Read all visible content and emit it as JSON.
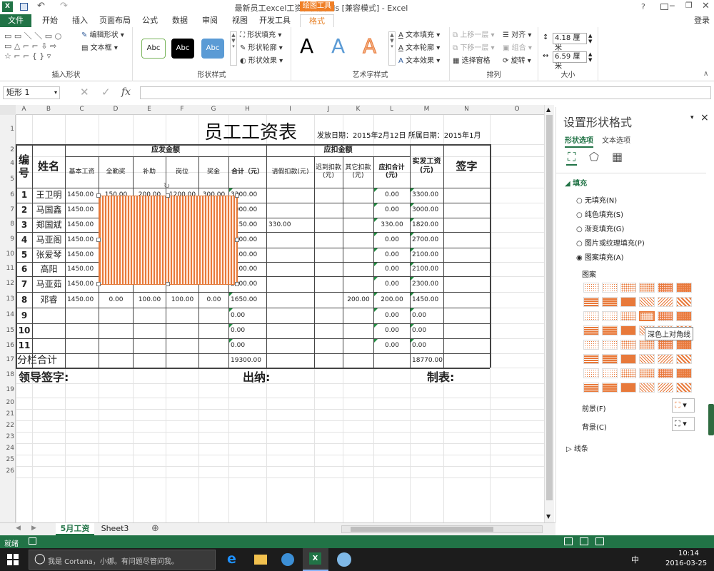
{
  "window": {
    "title": "最新员工excel工资表模板.xls [兼容模式] - Excel",
    "help": "?",
    "login": "登录"
  },
  "ribbon": {
    "tabs": [
      "文件",
      "开始",
      "插入",
      "页面布局",
      "公式",
      "数据",
      "审阅",
      "视图",
      "开发工具",
      "格式"
    ],
    "context_tab": "绘图工具",
    "insert_shapes": {
      "label": "插入形状",
      "edit_shape": "编辑形状",
      "textbox": "文本框"
    },
    "shape_styles": {
      "label": "形状样式",
      "style_text": "Abc",
      "fill": "形状填充",
      "outline": "形状轮廓",
      "effects": "形状效果"
    },
    "art_styles": {
      "label": "艺术字样式",
      "letter": "A",
      "text_fill": "文本填充",
      "text_outline": "文本轮廓",
      "text_effects": "文本效果"
    },
    "arrange": {
      "label": "排列",
      "bring_forward": "上移一层",
      "send_backward": "下移一层",
      "selection_pane": "选择窗格",
      "align": "对齐",
      "group": "组合",
      "rotate": "旋转"
    },
    "size": {
      "label": "大小",
      "height": "4.18 厘米",
      "width": "6.59 厘米"
    }
  },
  "formula_bar": {
    "name_box": "矩形 1",
    "fx": "fx"
  },
  "sheet": {
    "columns": [
      "A",
      "B",
      "C",
      "D",
      "E",
      "F",
      "G",
      "H",
      "I",
      "J",
      "K",
      "L",
      "M",
      "N",
      "O"
    ],
    "rows": [
      "1",
      "2",
      "4",
      "5",
      "6",
      "7",
      "8",
      "9",
      "10",
      "11",
      "12",
      "13",
      "14",
      "15",
      "16",
      "17",
      "18",
      "19",
      "20",
      "21",
      "22",
      "23",
      "24",
      "25",
      "26"
    ],
    "title": "员工工资表",
    "issue_info": "发放日期：2015年2月12日 所属日期：2015年1月",
    "h_no": "编号",
    "h_name": "姓名",
    "h_payable": "应发金额",
    "h_deduct": "应扣金额",
    "h_base": "基本工资",
    "h_bonus": "全勤奖",
    "h_subsidy": "补助",
    "h_post": "岗位",
    "h_prize": "奖金",
    "h_total": "合计（元）",
    "h_leave": "请假扣款(元)",
    "h_late": "迟到扣款(元)",
    "h_other": "其它扣款(元)",
    "h_dtotal": "应扣合计(元)",
    "h_net": "实发工资(元)",
    "h_sign": "签字",
    "data_rows": [
      {
        "no": "1",
        "name": "王卫明",
        "base": "1450.00",
        "bonus": "150.00",
        "subsidy": "200.00",
        "post": "1200.00",
        "prize": "300.00",
        "total": "3300.00",
        "leave": "",
        "late": "",
        "other": "",
        "dtotal": "0.00",
        "net": "3300.00"
      },
      {
        "no": "2",
        "name": "马国鑫",
        "base": "1450.00",
        "bonus": "",
        "subsidy": "",
        "post": "",
        "prize": "",
        "total": "3000.00",
        "leave": "",
        "late": "",
        "other": "",
        "dtotal": "0.00",
        "net": "3000.00"
      },
      {
        "no": "3",
        "name": "郑国斌",
        "base": "1450.00",
        "bonus": "",
        "subsidy": "",
        "post": "",
        "prize": "",
        "total": "2150.00",
        "leave": "330.00",
        "late": "",
        "other": "",
        "dtotal": "330.00",
        "net": "1820.00"
      },
      {
        "no": "4",
        "name": "马亚阁",
        "base": "1450.00",
        "bonus": "",
        "subsidy": "",
        "post": "",
        "prize": "",
        "total": "2700.00",
        "leave": "",
        "late": "",
        "other": "",
        "dtotal": "0.00",
        "net": "2700.00"
      },
      {
        "no": "5",
        "name": "张爱琴",
        "base": "1450.00",
        "bonus": "",
        "subsidy": "",
        "post": "",
        "prize": "",
        "total": "2100.00",
        "leave": "",
        "late": "",
        "other": "",
        "dtotal": "0.00",
        "net": "2100.00"
      },
      {
        "no": "6",
        "name": "高阳",
        "base": "1450.00",
        "bonus": "",
        "subsidy": "",
        "post": "",
        "prize": "",
        "total": "2100.00",
        "leave": "",
        "late": "",
        "other": "",
        "dtotal": "0.00",
        "net": "2100.00"
      },
      {
        "no": "7",
        "name": "马亚茹",
        "base": "1450.00",
        "bonus": "",
        "subsidy": "",
        "post": "",
        "prize": "",
        "total": "2300.00",
        "leave": "",
        "late": "",
        "other": "",
        "dtotal": "0.00",
        "net": "2300.00"
      },
      {
        "no": "8",
        "name": "邓睿",
        "base": "1450.00",
        "bonus": "0.00",
        "subsidy": "100.00",
        "post": "100.00",
        "prize": "0.00",
        "total": "1650.00",
        "leave": "",
        "late": "",
        "other": "200.00",
        "dtotal": "200.00",
        "net": "1450.00"
      },
      {
        "no": "9",
        "name": "",
        "base": "",
        "bonus": "",
        "subsidy": "",
        "post": "",
        "prize": "",
        "total": "0.00",
        "leave": "",
        "late": "",
        "other": "",
        "dtotal": "0.00",
        "net": "0.00"
      },
      {
        "no": "10",
        "name": "",
        "base": "",
        "bonus": "",
        "subsidy": "",
        "post": "",
        "prize": "",
        "total": "0.00",
        "leave": "",
        "late": "",
        "other": "",
        "dtotal": "0.00",
        "net": "0.00"
      },
      {
        "no": "11",
        "name": "",
        "base": "",
        "bonus": "",
        "subsidy": "",
        "post": "",
        "prize": "",
        "total": "0.00",
        "leave": "",
        "late": "",
        "other": "",
        "dtotal": "0.00",
        "net": "0.00"
      }
    ],
    "subtotal_label": "分栏合计",
    "subtotal_total": "19300.00",
    "subtotal_net": "18770.00",
    "leader_sign": "领导签字:",
    "cashier": "出纳:",
    "maker": "制表:"
  },
  "pane": {
    "title": "设置形状格式",
    "close": "×",
    "tab_shape": "形状选项",
    "tab_text": "文本选项",
    "fill_section": "填充",
    "fill_options": [
      "无填充(N)",
      "纯色填充(S)",
      "渐变填充(G)",
      "图片或纹理填充(P)",
      "图案填充(A)"
    ],
    "selected_fill": "图案填充(A)",
    "pattern_label": "图案",
    "tooltip": "深色上对角线",
    "foreground": "前景(F)",
    "background": "背景(C)",
    "line_section": "线条",
    "pattern_color": "#e8793a"
  },
  "sheet_tabs": [
    "5月工资",
    "Sheet3"
  ],
  "active_sheet": "5月工资",
  "status": {
    "ready": "就绪"
  },
  "taskbar": {
    "cortana": "我是 Cortana，小娜。有问题尽管问我。",
    "time": "10:14",
    "date": "2016-03-25",
    "ime": "中"
  },
  "colors": {
    "excel_green": "#217346",
    "accent": "#e8793a"
  }
}
